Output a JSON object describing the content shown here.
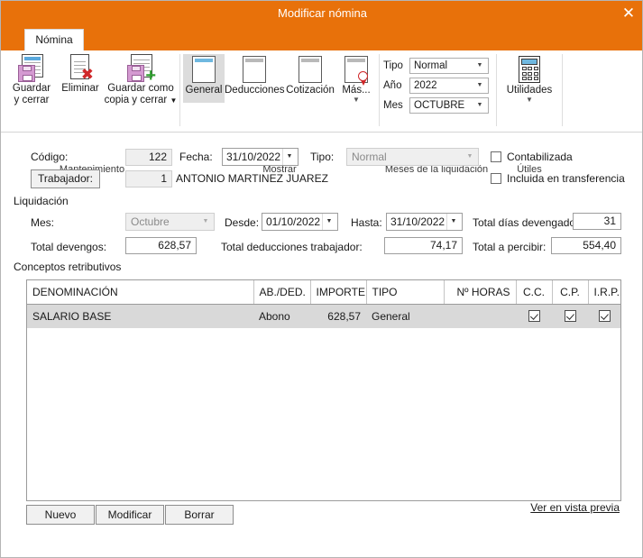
{
  "window": {
    "title": "Modificar nómina",
    "close_icon": "close-icon"
  },
  "ribbon": {
    "tab_label": "Nómina",
    "groups": [
      {
        "name": "Mantenimiento",
        "label": "Mantenimiento"
      },
      {
        "name": "Mostrar",
        "label": "Mostrar"
      },
      {
        "name": "Meses de la liquidación",
        "label": "Meses de la liquidación"
      },
      {
        "name": "Útiles",
        "label": "Útiles"
      }
    ],
    "maintenance": {
      "save_close": "Guardar\ny cerrar",
      "save_close_l1": "Guardar",
      "save_close_l2": "y cerrar",
      "delete": "Eliminar",
      "save_copy_l1": "Guardar como",
      "save_copy_l2": "copia y cerrar"
    },
    "show": {
      "general": "General",
      "deducciones": "Deducciones",
      "cotizacion": "Cotización",
      "mas": "Más..."
    },
    "liquidacion": {
      "tipo_label": "Tipo",
      "tipo_value": "Normal",
      "anio_label": "Año",
      "anio_value": "2022",
      "mes_label": "Mes",
      "mes_value": "OCTUBRE"
    },
    "utiles": {
      "utilidades": "Utilidades"
    }
  },
  "form": {
    "codigo_label": "Código:",
    "codigo_value": "122",
    "fecha_label": "Fecha:",
    "fecha_value": "31/10/2022",
    "tipo_label": "Tipo:",
    "tipo_value": "Normal",
    "trabajador_button": "Trabajador:",
    "trabajador_code": "1",
    "trabajador_name": "ANTONIO MARTINEZ JUAREZ",
    "contabilizada_label": "Contabilizada",
    "incluida_label": "Incluida en transferencia",
    "liquidacion_section": "Liquidación",
    "mes_label": "Mes:",
    "mes_value": "Octubre",
    "desde_label": "Desde:",
    "desde_value": "01/10/2022",
    "hasta_label": "Hasta:",
    "hasta_value": "31/10/2022",
    "total_dias_label": "Total días devengados:",
    "total_dias_value": "31",
    "total_devengos_label": "Total devengos:",
    "total_devengos_value": "628,57",
    "total_deducciones_label": "Total deducciones trabajador:",
    "total_deducciones_value": "74,17",
    "total_percibir_label": "Total a percibir:",
    "total_percibir_value": "554,40"
  },
  "grid": {
    "section_label": "Conceptos retributivos",
    "columns": [
      "DENOMINACIÓN",
      "AB./DED.",
      "IMPORTE",
      "TIPO",
      "Nº HORAS",
      "C.C.",
      "C.P.",
      "I.R.P.F."
    ],
    "rows": [
      {
        "denominacion": "SALARIO BASE",
        "abded": "Abono",
        "importe": "628,57",
        "tipo": "General",
        "horas": "",
        "cc": true,
        "cp": true,
        "irpf": true
      }
    ],
    "buttons": {
      "nuevo": "Nuevo",
      "modificar": "Modificar",
      "borrar": "Borrar"
    },
    "preview_link": "Ver en vista previa"
  },
  "colors": {
    "title_bar": "#E8710A",
    "row_selected": "#d9d9d9",
    "accent_blue": "#6fb8e0"
  }
}
